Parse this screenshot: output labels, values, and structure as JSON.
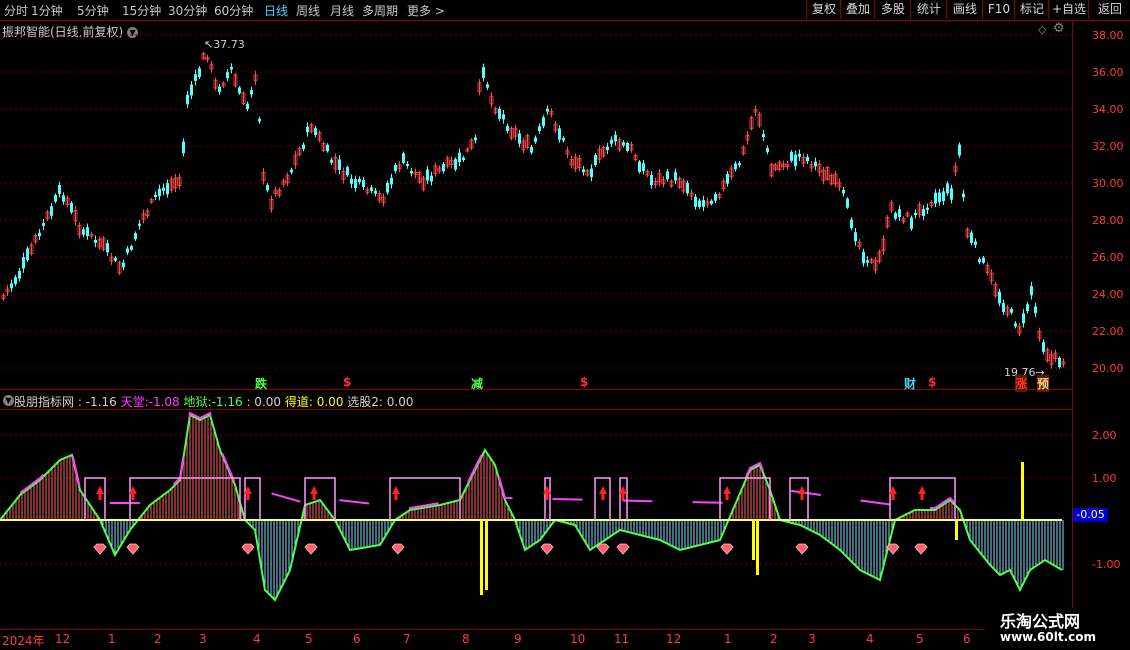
{
  "toolbar": {
    "periods": [
      "分时",
      "1分钟",
      "5分钟",
      "15分钟",
      "30分钟",
      "60分钟",
      "日线",
      "周线",
      "月线",
      "多周期",
      "更多 >"
    ],
    "active_period": "日线",
    "buttons": [
      "复权",
      "叠加",
      "多股",
      "统计",
      "画线",
      "F10",
      "标记",
      "+自选",
      "返回"
    ]
  },
  "main_panel": {
    "title": "振邦智能(日线,前复权)",
    "high_label": "37.73",
    "low_label": "19.76",
    "y_ticks": [
      "38.00",
      "36.00",
      "34.00",
      "32.00",
      "30.00",
      "28.00",
      "26.00",
      "24.00",
      "22.00",
      "20.00"
    ],
    "markers": [
      {
        "text": "跌",
        "color": "#4dff4d"
      },
      {
        "text": "$",
        "color": "#ff3030"
      },
      {
        "text": "减",
        "color": "#4dff4d"
      },
      {
        "text": "$",
        "color": "#ff3030"
      },
      {
        "text": "财",
        "color": "#4ad3ff"
      },
      {
        "text": "$",
        "color": "#ff3030"
      },
      {
        "text": "涨",
        "color": "#ff3030"
      },
      {
        "text": "预",
        "color": "#ffd27f"
      }
    ]
  },
  "indicator_panel": {
    "name": "股朋指标网",
    "value": ": -1.16",
    "tiantang_label": "天堂:",
    "tiantang_value": "-1.08",
    "diyu_label": "地狱:",
    "diyu_value": "-1.16",
    "extra_value": ": 0.00",
    "dedao_label": "得道:",
    "dedao_value": "0.00",
    "xuangu_label": "选股2:",
    "xuangu_value": "0.00",
    "y_ticks": [
      "2.00",
      "1.00",
      "-0.05",
      "-1.00"
    ],
    "current_value": "-0.05",
    "colors": {
      "tiantang": "#ff40ff",
      "diyu": "#4dff4d",
      "dedao": "#ffff00",
      "name": "#d0d0d0"
    }
  },
  "x_axis": {
    "labels": [
      "2024年",
      "12",
      "1",
      "2",
      "3",
      "4",
      "5",
      "6",
      "7",
      "8",
      "9",
      "10",
      "11",
      "12",
      "1",
      "2",
      "3",
      "4",
      "5",
      "6"
    ]
  },
  "watermark": {
    "line1": "乐淘公式网",
    "line2": "www.60lt.com"
  }
}
